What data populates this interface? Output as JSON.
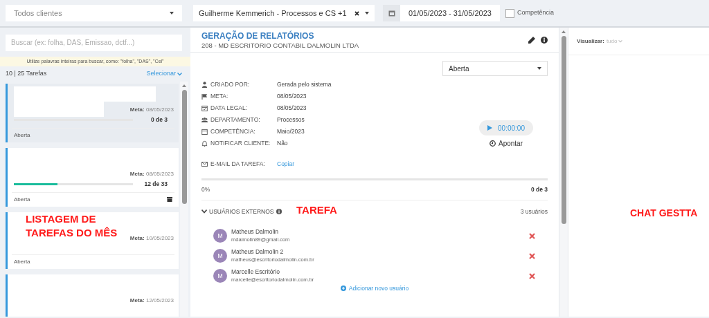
{
  "filters": {
    "client_select": {
      "placeholder": "Todos clientes"
    },
    "responsible_select": {
      "value": "Guilherme Kemmerich - Processos e CS +1"
    },
    "date_range": {
      "value": "01/05/2023 - 31/05/2023"
    },
    "competencia": {
      "label": "Competência",
      "checked": false
    }
  },
  "sidebar": {
    "search": {
      "placeholder": "Buscar (ex: folha, DAS, Emissao, dctf...)"
    },
    "hint": "Utilize palavras inteiras para buscar, como: \"folha\", \"DAS\", \"Cel\"",
    "count": "10 | 25 Tarefas",
    "select_link": "Selecionar",
    "tasks": [
      {
        "selected": true,
        "redacted": true,
        "meta_label": "Meta:",
        "meta": "08/05/2023",
        "progress": {
          "level": 0,
          "text": "0 de 3"
        },
        "status": "Aberta"
      },
      {
        "selected": false,
        "meta_label": "Meta:",
        "meta": "08/05/2023",
        "progress": {
          "level": 0.364,
          "text": "12 de 33"
        },
        "status": "Aberta",
        "archived": true
      },
      {
        "selected": false,
        "meta_label": "Meta:",
        "meta": "10/05/2023",
        "status": "Aberta"
      },
      {
        "selected": false,
        "meta_label": "Meta:",
        "meta": "12/05/2023"
      }
    ]
  },
  "task": {
    "title": "GERAÇÃO DE RELATÓRIOS",
    "client": "208 - MD ESCRITORIO CONTABIL DALMOLIN LTDA",
    "status_select": {
      "value": "Aberta"
    },
    "details": [
      {
        "kind": "user",
        "label": "CRIADO POR:",
        "value": "Gerada pelo sistema"
      },
      {
        "kind": "flag",
        "label": "META:",
        "value": "08/05/2023"
      },
      {
        "kind": "calendar-check",
        "label": "DATA LEGAL:",
        "value": "08/05/2023"
      },
      {
        "kind": "users",
        "label": "DEPARTAMENTO:",
        "value": "Processos"
      },
      {
        "kind": "calendar",
        "label": "COMPETÊNCIA:",
        "value": "Maio/2023"
      },
      {
        "kind": "bell",
        "label": "NOTIFICAR CLIENTE:",
        "value": "Não"
      }
    ],
    "email": {
      "label": "E-MAIL DA TAREFA:",
      "link": "Copiar"
    },
    "timer": "00:00:00",
    "apontar": "Apontar",
    "progress": {
      "level": 0,
      "percent": "0%",
      "text": "0 de 3"
    },
    "external_users": {
      "title": "USUÁRIOS EXTERNOS",
      "expanded": true,
      "count": "3 usuários",
      "users": [
        {
          "initial": "M",
          "name": "Matheus Dalmolin",
          "email": "mdalmolin89@gmail.com"
        },
        {
          "initial": "M",
          "name": "Matheus Dalmolin 2",
          "email": "matheus@escritoriodalmolin.com.br"
        },
        {
          "initial": "M",
          "name": "Marcelle Escritório",
          "email": "marcelle@escritoriodalmolin.com.br"
        }
      ],
      "add_link": "Adicionar novo usuário"
    }
  },
  "chat": {
    "view_label": "Visualizar:",
    "view_value": "tudo"
  },
  "annotations": [
    "LISTAGEM DE TAREFAS DO MÊS",
    "TAREFA",
    "CHAT GESTTA"
  ]
}
